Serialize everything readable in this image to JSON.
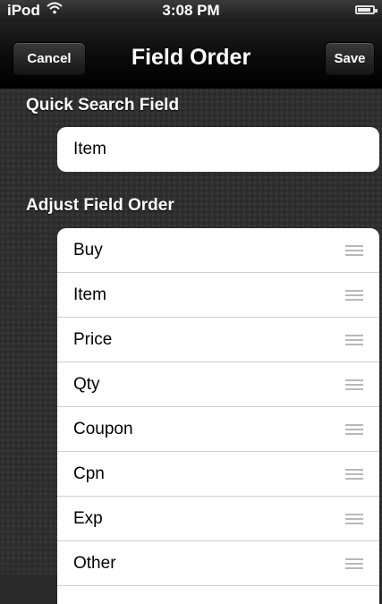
{
  "status_bar": {
    "carrier": "iPod",
    "time": "3:08 PM"
  },
  "nav": {
    "title": "Field Order",
    "cancel_label": "Cancel",
    "save_label": "Save"
  },
  "quick_search": {
    "header": "Quick Search Field",
    "value": "Item"
  },
  "field_order": {
    "header": "Adjust Field Order",
    "items": [
      {
        "label": "Buy"
      },
      {
        "label": "Item"
      },
      {
        "label": "Price"
      },
      {
        "label": "Qty"
      },
      {
        "label": "Coupon"
      },
      {
        "label": "Cpn"
      },
      {
        "label": "Exp"
      },
      {
        "label": "Other"
      }
    ]
  },
  "icons": {
    "wifi": "wifi-icon",
    "battery": "battery-icon",
    "reorder": "reorder-grip-icon"
  }
}
